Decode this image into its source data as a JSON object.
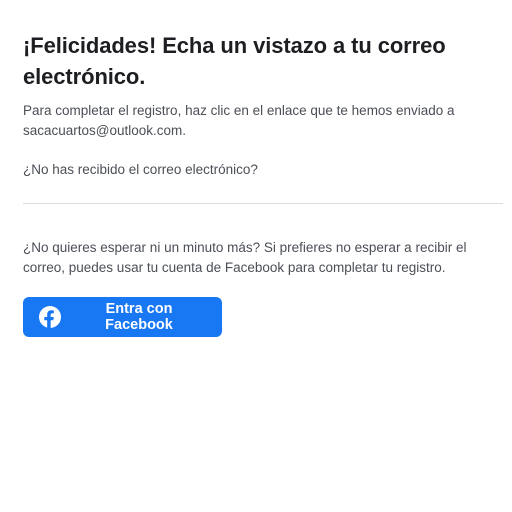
{
  "page": {
    "title": "¡Felicidades! Echa un vistazo a tu correo electrónico.",
    "description": "Para completar el registro, haz clic en el enlace que te hemos enviado a sacacuartos@outlook.com.",
    "not_received_link": "¿No has recibido el correo electrónico?",
    "wait_text": "¿No quieres esperar ni un minuto más? Si prefieres no esperar a recibir el correo, puedes usar tu cuenta de Facebook para completar tu registro."
  },
  "facebook_button": {
    "label": "Entra con Facebook",
    "icon": "facebook-icon",
    "color": "#1877f2"
  },
  "colors": {
    "text_primary": "#1c1e21",
    "text_secondary": "#4b4f56",
    "divider": "#dadde1",
    "background": "#ffffff"
  }
}
